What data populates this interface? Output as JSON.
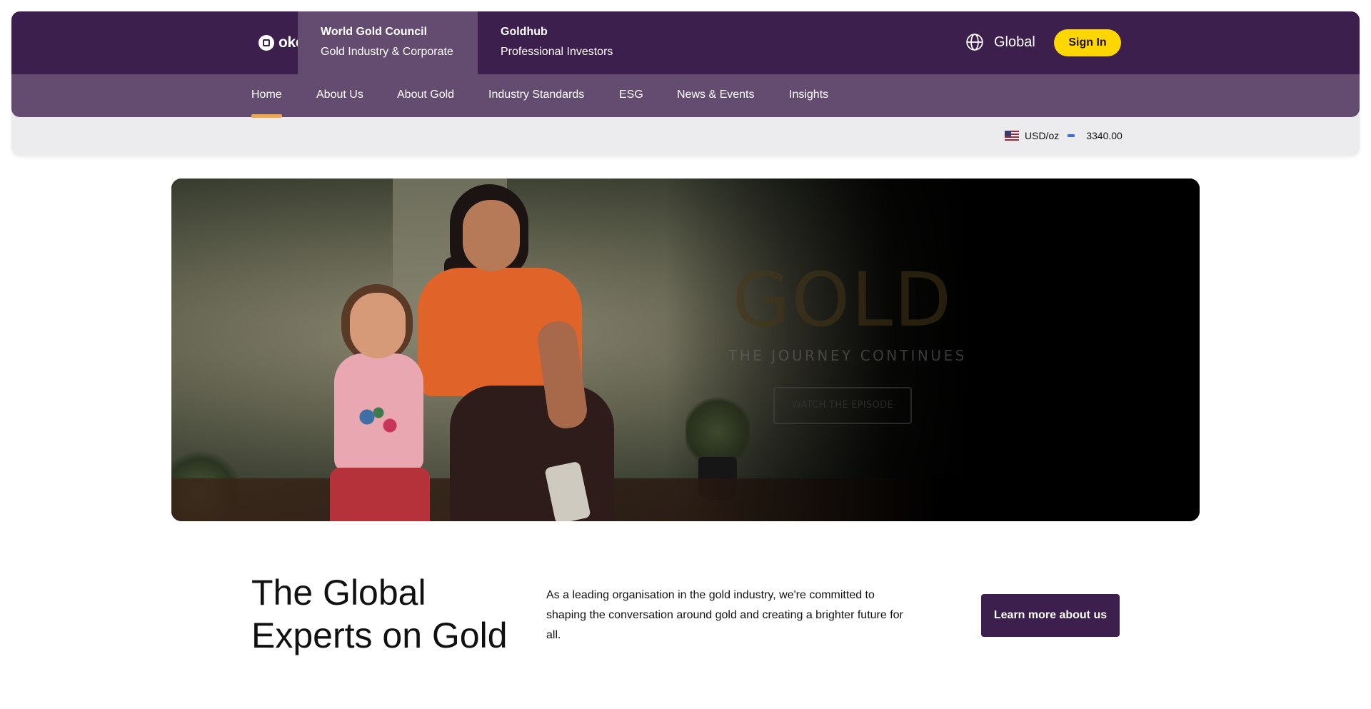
{
  "brand": {
    "logo_text": "okcoin"
  },
  "site_tabs": [
    {
      "title": "World Gold Council",
      "subtitle": "Gold Industry & Corporate",
      "active": true
    },
    {
      "title": "Goldhub",
      "subtitle": "Professional Investors",
      "active": false
    }
  ],
  "header": {
    "region_label": "Global",
    "region_icon": "globe-icon",
    "signin_label": "Sign In"
  },
  "nav": {
    "items": [
      "Home",
      "About Us",
      "About Gold",
      "Industry Standards",
      "ESG",
      "News & Events",
      "Insights"
    ],
    "active": "Home"
  },
  "ticker": {
    "currency_unit": "USD/oz",
    "flag_icon": "us-flag-icon",
    "price": "3340.00"
  },
  "hero": {
    "headline": "GOLD",
    "tagline": "THE JOURNEY CONTINUES",
    "cta_label": "WATCH THE EPISODE"
  },
  "intro": {
    "title": "The Global Experts on Gold",
    "body": "As a leading organisation in the gold industry, we're committed to shaping the conversation around gold and creating a brighter future for all.",
    "cta_label": "Learn more about us"
  },
  "colors": {
    "top_bar": "#3c1f4c",
    "nav_bar": "#644c70",
    "signin_button": "#ffd700",
    "active_underline": "#f0a850",
    "cta_button": "#3c1f4c"
  }
}
